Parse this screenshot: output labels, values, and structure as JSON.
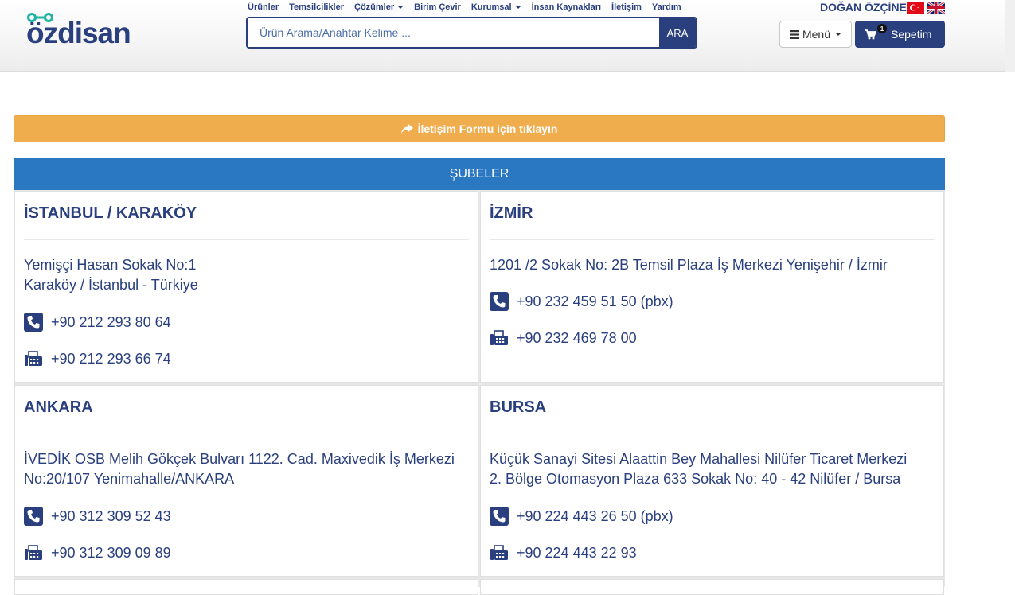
{
  "header": {
    "logo_text": "özdisan",
    "nav": [
      {
        "label": "Ürünler",
        "dropdown": false
      },
      {
        "label": "Temsilcilikler",
        "dropdown": false
      },
      {
        "label": "Çözümler",
        "dropdown": true
      },
      {
        "label": "Birim Çevir",
        "dropdown": false
      },
      {
        "label": "Kurumsal",
        "dropdown": true
      },
      {
        "label": "İnsan Kaynakları",
        "dropdown": false
      },
      {
        "label": "İletişim",
        "dropdown": false
      },
      {
        "label": "Yardım",
        "dropdown": false
      }
    ],
    "search": {
      "placeholder": "Ürün Arama/Anahtar Kelime ...",
      "button_label": "ARA"
    },
    "user_name": "DOĞAN ÖZÇİNE",
    "menu_label": "Menü",
    "cart": {
      "label": "Sepetim",
      "count": "1"
    }
  },
  "contact_bar": {
    "label": "İletişim Formu için tıklayın"
  },
  "branches": {
    "title": "ŞUBELER",
    "items": [
      {
        "name": "İSTANBUL / KARAKÖY",
        "address_lines": [
          "Yemişçi Hasan Sokak No:1",
          "Karaköy / İstanbul - Türkiye"
        ],
        "phone": "+90 212 293 80 64",
        "fax": "+90 212 293 66 74"
      },
      {
        "name": "İZMİR",
        "address_lines": [
          "1201 /2 Sokak No: 2B Temsil Plaza İş Merkezi Yenişehir / İzmir"
        ],
        "phone": "+90 232 459 51 50 (pbx)",
        "fax": "+90 232 469 78 00"
      },
      {
        "name": "ANKARA",
        "address_lines": [
          "İVEDİK OSB Melih Gökçek Bulvarı 1122. Cad. Maxivedik İş Merkezi",
          "No:20/107 Yenimahalle/ANKARA"
        ],
        "phone": "+90 312 309 52 43",
        "fax": "+90 312 309 09 89"
      },
      {
        "name": "BURSA",
        "address_lines": [
          "Küçük Sanayi Sitesi Alaattin Bey Mahallesi Nilüfer Ticaret Merkezi",
          "2. Bölge Otomasyon Plaza 633 Sokak No: 40 - 42 Nilüfer / Bursa"
        ],
        "phone": "+90 224 443 26 50 (pbx)",
        "fax": "+90 224 443 22 93"
      }
    ]
  },
  "icons": {
    "phone": "phone-icon",
    "fax": "fax-icon",
    "cart": "cart-icon",
    "menu": "hamburger-icon",
    "share": "share-arrow-icon"
  },
  "colors": {
    "brand_navy": "#2a3f7e",
    "logo_teal": "#1fb3a0",
    "contact_orange": "#f0ad4e",
    "branches_blue": "#2a78c2"
  }
}
